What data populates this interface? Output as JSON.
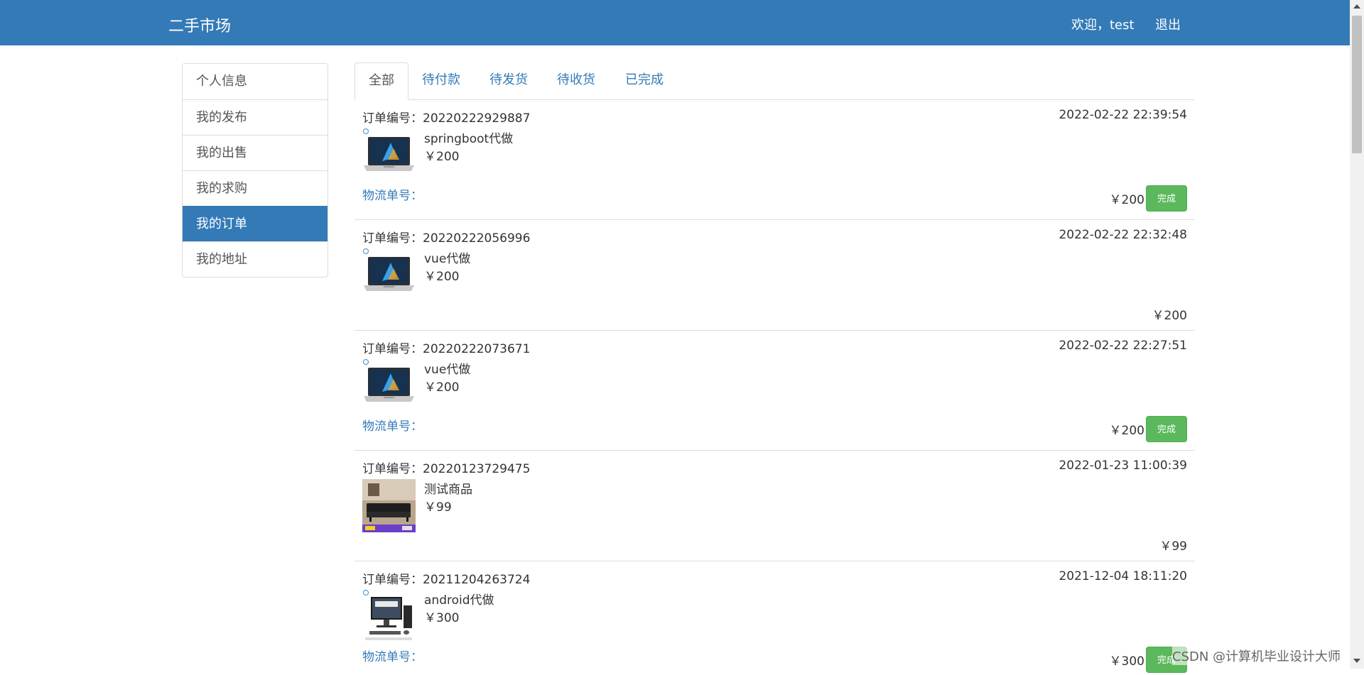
{
  "header": {
    "brand": "二手市场",
    "welcome": "欢迎，test",
    "logout": "退出",
    "color": "#337ab7"
  },
  "sidebar": {
    "items": [
      {
        "label": "个人信息"
      },
      {
        "label": "我的发布"
      },
      {
        "label": "我的出售"
      },
      {
        "label": "我的求购"
      },
      {
        "label": "我的订单",
        "active": true
      },
      {
        "label": "我的地址"
      }
    ]
  },
  "tabs": [
    {
      "label": "全部",
      "active": true
    },
    {
      "label": "待付款"
    },
    {
      "label": "待发货"
    },
    {
      "label": "待收货"
    },
    {
      "label": "已完成"
    }
  ],
  "orders": [
    {
      "order_no": "订单编号：20220222929887",
      "time": "2022-02-22 22:39:54",
      "title": "springboot代做",
      "price": "￥200",
      "logistics": "物流单号：",
      "total": "￥200",
      "button": "完成",
      "thumb": "laptop"
    },
    {
      "order_no": "订单编号：20220222056996",
      "time": "2022-02-22 22:32:48",
      "title": "vue代做",
      "price": "￥200",
      "total": "￥200",
      "thumb": "laptop"
    },
    {
      "order_no": "订单编号：20220222073671",
      "time": "2022-02-22 22:27:51",
      "title": "vue代做",
      "price": "￥200",
      "logistics": "物流单号：",
      "total": "￥200",
      "button": "完成",
      "thumb": "laptop"
    },
    {
      "order_no": "订单编号：20220123729475",
      "time": "2022-01-23 11:00:39",
      "title": "测试商品",
      "price": "￥99",
      "total": "￥99",
      "thumb": "sofa"
    },
    {
      "order_no": "订单编号：20211204263724",
      "time": "2021-12-04 18:11:20",
      "title": "android代做",
      "price": "￥300",
      "logistics": "物流单号：",
      "total": "￥300",
      "button": "完成",
      "thumb": "desktop"
    }
  ],
  "watermark": "CSDN @计算机毕业设计大师"
}
